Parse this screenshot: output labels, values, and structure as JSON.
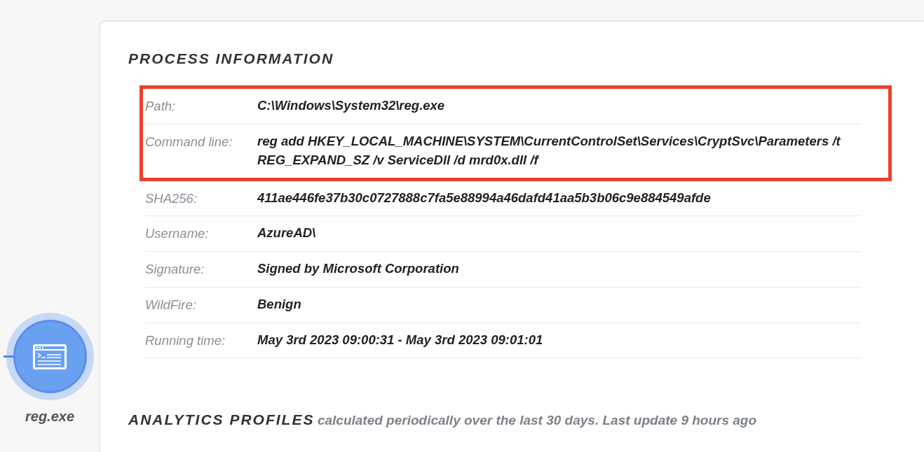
{
  "process_node": {
    "label": "reg.exe"
  },
  "process_information": {
    "title": "PROCESS INFORMATION",
    "rows": [
      {
        "label": "Path:",
        "value": "C:\\Windows\\System32\\reg.exe",
        "highlighted": true
      },
      {
        "label": "Command line:",
        "value": "reg add HKEY_LOCAL_MACHINE\\SYSTEM\\CurrentControlSet\\Services\\CryptSvc\\Parameters /t REG_EXPAND_SZ /v ServiceDll /d mrd0x.dll /f",
        "highlighted": true
      },
      {
        "label": "SHA256:",
        "value": "411ae446fe37b30c0727888c7fa5e88994a46dafd41aa5b3b06c9e884549afde",
        "highlighted": false
      },
      {
        "label": "Username:",
        "value": "AzureAD\\",
        "highlighted": false
      },
      {
        "label": "Signature:",
        "value": "Signed by Microsoft Corporation",
        "highlighted": false
      },
      {
        "label": "WildFire:",
        "value": "Benign",
        "highlighted": false
      },
      {
        "label": "Running time:",
        "value": "May 3rd 2023 09:00:31 - May 3rd 2023 09:01:01",
        "highlighted": false
      }
    ]
  },
  "analytics_profiles": {
    "title": "ANALYTICS PROFILES",
    "subtitle": "calculated periodically over the last 30 days. Last update 9 hours ago"
  }
}
